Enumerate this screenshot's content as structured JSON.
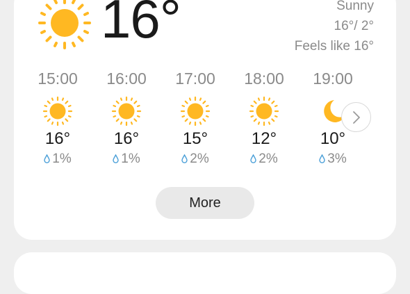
{
  "current": {
    "temperature": "16°",
    "condition": "Sunny",
    "high_low": "16°/ 2°",
    "feels_like": "Feels like 16°",
    "icon": "sun-icon"
  },
  "hourly": [
    {
      "time": "15:00",
      "temp": "16°",
      "precip": "1%",
      "icon": "sun-icon"
    },
    {
      "time": "16:00",
      "temp": "16°",
      "precip": "1%",
      "icon": "sun-icon"
    },
    {
      "time": "17:00",
      "temp": "15°",
      "precip": "2%",
      "icon": "sun-icon"
    },
    {
      "time": "18:00",
      "temp": "12°",
      "precip": "2%",
      "icon": "sun-icon"
    },
    {
      "time": "19:00",
      "temp": "10°",
      "precip": "3%",
      "icon": "moon-icon"
    }
  ],
  "more_label": "More",
  "colors": {
    "sun": "#ffb822",
    "moon": "#ffb822",
    "drop": "#4a9fd8",
    "card": "#ffffff",
    "background": "#efefef"
  }
}
